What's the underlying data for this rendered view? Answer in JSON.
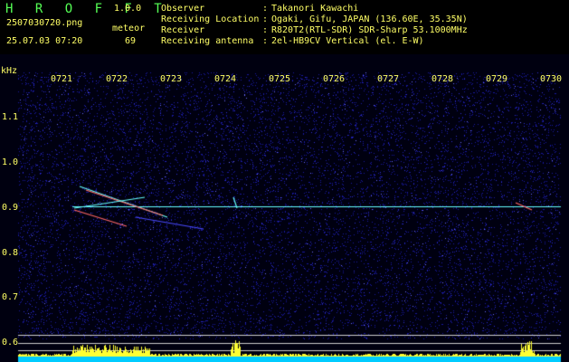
{
  "app": {
    "name": "H R O F F T",
    "version": "1.0.0"
  },
  "file": {
    "name": "2507030720.png",
    "datetime": "25.07.03 07:20"
  },
  "meteor": {
    "label": "meteor",
    "count": "69"
  },
  "info": [
    {
      "label": "Observer",
      "value": "Takanori Kawachi"
    },
    {
      "label": "Receiving Location",
      "value": "Ogaki, Gifu, JAPAN (136.60E, 35.35N)"
    },
    {
      "label": "Receiver",
      "value": "R820T2(RTL-SDR) SDR-Sharp 53.1000MHz"
    },
    {
      "label": "Receiving antenna",
      "value": "2el-HB9CV Vertical (el. E-W)"
    }
  ],
  "separator": ":",
  "axis": {
    "unit": "kHz",
    "y_ticks": [
      "1.1",
      "1.0",
      "0.9",
      "0.8",
      "0.7",
      "0.6"
    ],
    "x_ticks": [
      "0721",
      "0722",
      "0723",
      "0724",
      "0725",
      "0726",
      "0727",
      "0728",
      "0729",
      "0730"
    ]
  },
  "colors": {
    "text": "#ffff66",
    "logo": "#55ff55",
    "background": "#000010",
    "noise": "#1a1aa0",
    "carrier": "#66ffff",
    "meteor_trace": "#ff6666",
    "bar": "#ffff33",
    "bar_base": "#00ccff"
  }
}
